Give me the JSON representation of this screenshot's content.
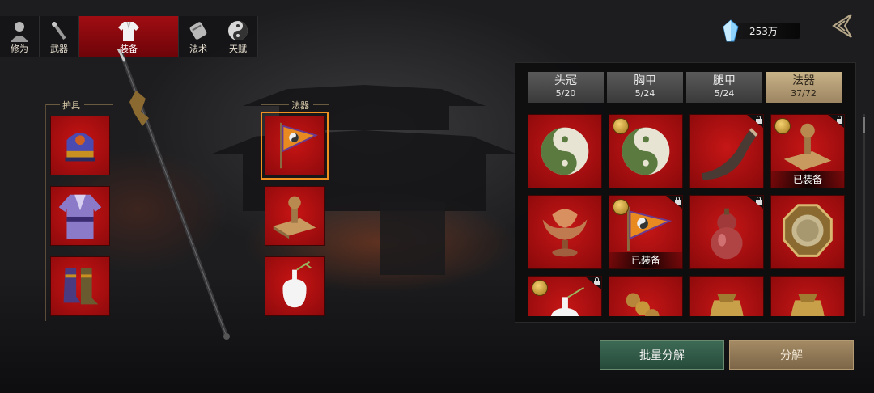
{
  "nav_tabs": [
    {
      "label": "修为",
      "icon": "cultivator-icon",
      "active": false
    },
    {
      "label": "武器",
      "icon": "weapon-icon",
      "active": false
    },
    {
      "label": "装备",
      "icon": "robe-icon",
      "active": true
    },
    {
      "label": "法术",
      "icon": "scroll-icon",
      "active": false
    },
    {
      "label": "天赋",
      "icon": "taiji-icon",
      "active": false
    }
  ],
  "currency": {
    "icon": "crystal-icon",
    "value": "253万"
  },
  "equipped": {
    "armor_label": "护具",
    "artifact_label": "法器",
    "armor": [
      {
        "icon": "helmet-icon"
      },
      {
        "icon": "robe-armor-icon"
      },
      {
        "icon": "boots-icon"
      }
    ],
    "artifacts": [
      {
        "icon": "taiji-flag-icon",
        "selected": true
      },
      {
        "icon": "seal-stamp-icon"
      },
      {
        "icon": "porcelain-vase-icon"
      }
    ]
  },
  "categories": [
    {
      "name": "头冠",
      "count": "5/20",
      "active": false
    },
    {
      "name": "胸甲",
      "count": "5/24",
      "active": false
    },
    {
      "name": "腿甲",
      "count": "5/24",
      "active": false
    },
    {
      "name": "法器",
      "count": "37/72",
      "active": true
    }
  ],
  "items": [
    {
      "icon": "green-taiji-icon",
      "coin": false,
      "locked": false,
      "equipped": ""
    },
    {
      "icon": "green-taiji-icon",
      "coin": true,
      "locked": false,
      "equipped": ""
    },
    {
      "icon": "horn-icon",
      "coin": false,
      "locked": true,
      "equipped": ""
    },
    {
      "icon": "seal-stamp-icon",
      "coin": true,
      "locked": true,
      "equipped": "已装备"
    },
    {
      "icon": "lotus-lamp-icon",
      "coin": false,
      "locked": false,
      "equipped": ""
    },
    {
      "icon": "taiji-flag-icon",
      "coin": true,
      "locked": true,
      "equipped": "已装备"
    },
    {
      "icon": "gourd-icon",
      "coin": false,
      "locked": true,
      "equipped": ""
    },
    {
      "icon": "bagua-mirror-icon",
      "coin": false,
      "locked": false,
      "equipped": ""
    },
    {
      "icon": "porcelain-vase-icon",
      "coin": true,
      "locked": true,
      "equipped": ""
    },
    {
      "icon": "coin-string-icon",
      "coin": false,
      "locked": false,
      "equipped": ""
    },
    {
      "icon": "money-pouch-icon",
      "coin": false,
      "locked": false,
      "equipped": ""
    },
    {
      "icon": "money-pouch-icon",
      "coin": false,
      "locked": false,
      "equipped": ""
    }
  ],
  "buttons": {
    "batch_decompose": "批量分解",
    "decompose": "分解"
  },
  "colors": {
    "active_tab": "#a00d12",
    "slot_red": "#c81414",
    "category_active": "#c8b288",
    "batch_button": "#3d6a55",
    "decompose_button": "#a48a64",
    "selection_outline": "#f09020"
  }
}
